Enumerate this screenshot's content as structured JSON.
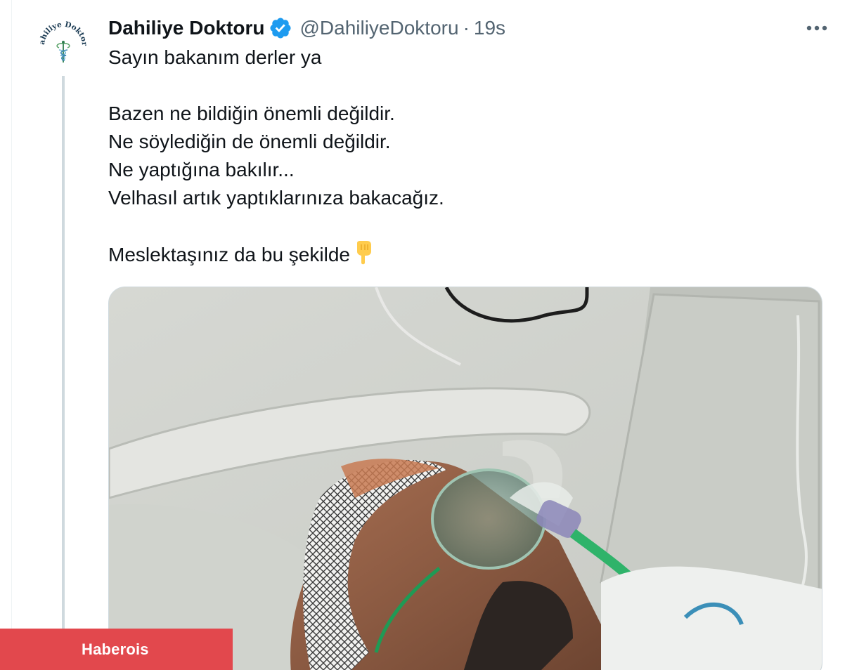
{
  "tweet": {
    "display_name": "Dahiliye Doktoru",
    "handle": "@DahiliyeDoktoru",
    "separator": "·",
    "time": "19s",
    "avatar_text": "Dahiliye Doktoru",
    "lines": [
      "Sayın bakanım derler ya",
      "",
      "Bazen ne bildiğin önemli değildir.",
      "Ne söylediğin de önemli değildir.",
      "Ne yaptığına bakılır...",
      "Velhasıl artık yaptıklarınıza bakacağız.",
      "",
      "Meslektaşınız da bu şekilde"
    ],
    "last_line_emoji": "pointing-down-hand-icon",
    "media_alt": "hospital-patient-photo"
  },
  "watermark": {
    "label": "Haberois"
  },
  "colors": {
    "verified_blue": "#1d9bf0",
    "secondary_text": "#536471",
    "watermark_red": "#e2484d"
  }
}
